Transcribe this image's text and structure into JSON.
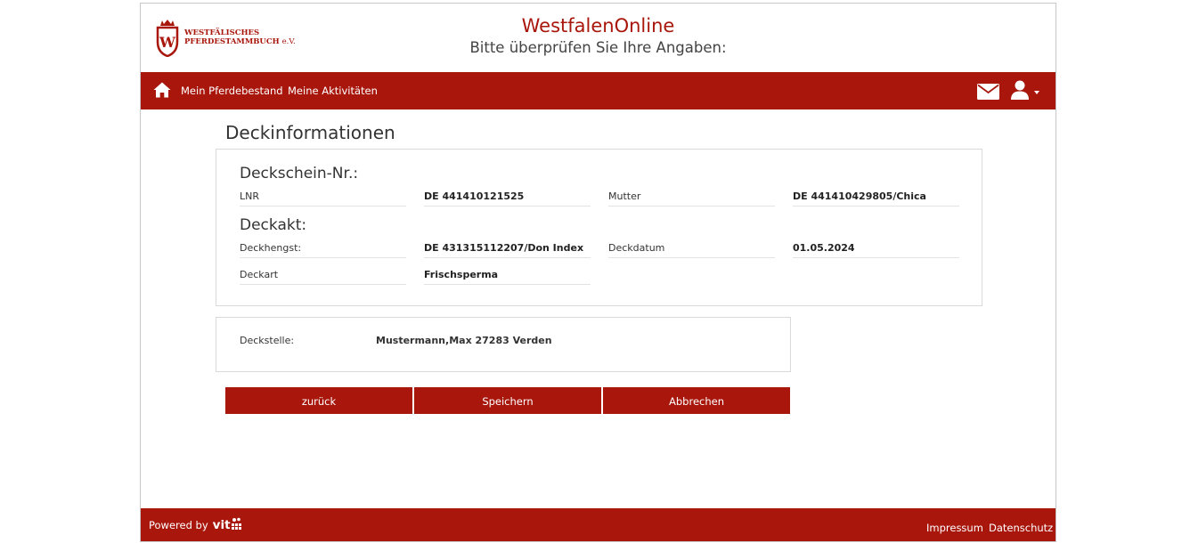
{
  "header": {
    "logo": {
      "line1": "WESTFÄLISCHES",
      "line2": "PFERDESTAMMBUCH",
      "suffix": "e.V.",
      "letter": "W"
    },
    "title": "WestfalenOnline",
    "subtitle": "Bitte überprüfen Sie Ihre Angaben:"
  },
  "nav": {
    "items": [
      {
        "label": "Mein Pferdebestand"
      },
      {
        "label": "Meine Aktivitäten"
      }
    ],
    "icons": [
      "home-icon",
      "mail-icon",
      "user-icon",
      "caret-down-icon"
    ]
  },
  "main": {
    "title": "Deckinformationen",
    "deckschein": {
      "heading": "Deckschein-Nr.:",
      "lnr_label": "LNR",
      "lnr_value": "DE 441410121525",
      "mutter_label": "Mutter",
      "mutter_value": "DE 441410429805/Chica"
    },
    "deckakt": {
      "heading": "Deckakt:",
      "hengst_label": "Deckhengst:",
      "hengst_value": "DE 431315112207/Don Index",
      "datum_label": "Deckdatum",
      "datum_value": "01.05.2024",
      "art_label": "Deckart",
      "art_value": "Frischsperma"
    },
    "deckstelle": {
      "label": "Deckstelle:",
      "value": "Mustermann,Max 27283 Verden"
    },
    "buttons": {
      "back": "zurück",
      "save": "Speichern",
      "cancel": "Abbrechen"
    }
  },
  "footer": {
    "powered_by": "Powered by",
    "brand": "vit",
    "impressum": "Impressum",
    "datenschutz": "Datenschutz"
  },
  "colors": {
    "brand_red": "#a8160c",
    "text": "#333333"
  }
}
